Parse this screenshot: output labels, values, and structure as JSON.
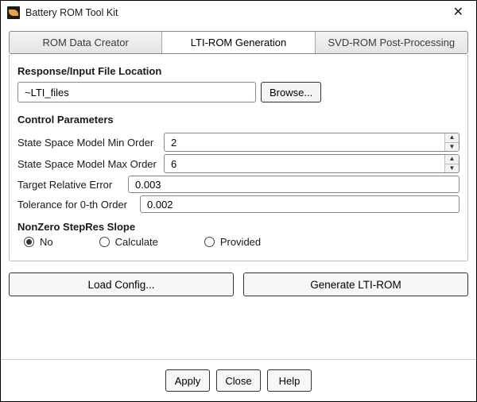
{
  "window": {
    "title": "Battery ROM Tool Kit"
  },
  "tabs": {
    "creator": "ROM Data Creator",
    "lti": "LTI-ROM Generation",
    "svd": "SVD-ROM Post-Processing"
  },
  "file_section": {
    "title": "Response/Input File Location",
    "path_value": "~LTI_files",
    "browse_label": "Browse..."
  },
  "control": {
    "title": "Control Parameters",
    "min_order_label": "State Space Model Min Order",
    "min_order_value": "2",
    "max_order_label": "State Space Model Max Order",
    "max_order_value": "6",
    "target_err_label": "Target Relative Error",
    "target_err_value": "0.003",
    "tol0_label": "Tolerance for 0-th Order",
    "tol0_value": "0.002",
    "slope_title": "NonZero StepRes Slope",
    "slope_no": "No",
    "slope_calc": "Calculate",
    "slope_prov": "Provided"
  },
  "buttons": {
    "load_cfg": "Load Config...",
    "generate": "Generate LTI-ROM",
    "apply": "Apply",
    "close": "Close",
    "help": "Help"
  }
}
